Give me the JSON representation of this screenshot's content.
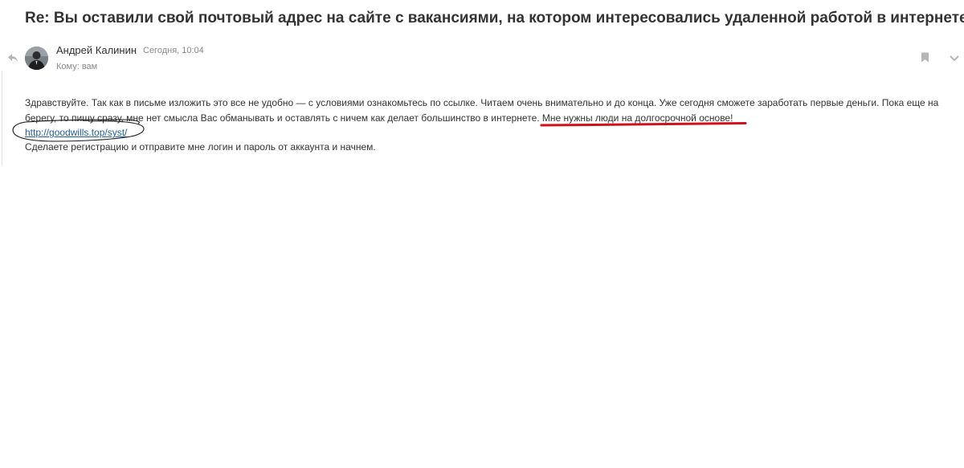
{
  "email": {
    "subject": "Re: Вы оставили свой почтовый адрес на сайте с вакансиями, на котором интересовались удаленной работой в интернете?",
    "sender": {
      "name": "Андрей Калинин",
      "date": "Сегодня, 10:04"
    },
    "recipient": "Кому: вам",
    "body": {
      "line1": "Здравствуйте. Так как в письме изложить это все не удобно — с условиями ознакомьтесь по ссылке. Читаем очень внимательно и до конца. Уже сегодня сможете заработать первые деньги. Пока еще на",
      "line2_main": "берегу, то пишу сразу, мне нет смысла Вас обманывать и оставлять с ничем как делает большинство в интернете. ",
      "line2_highlight": "Мне нужны люди на долгосрочной основе!",
      "link": "http://goodwills.top/syst/",
      "line4": "Сделаете регистрацию и отправите мне логин и пароль от аккаунта и начнем."
    }
  },
  "icons": {
    "reply": "reply-arrow-icon",
    "avatar": "user-photo",
    "bookmark": "bookmark-icon",
    "more": "more-vertical-icon"
  },
  "colors": {
    "link": "#1f5f9d",
    "underline_annotation": "#d0101a",
    "circle_annotation": "#1a1a1a"
  }
}
